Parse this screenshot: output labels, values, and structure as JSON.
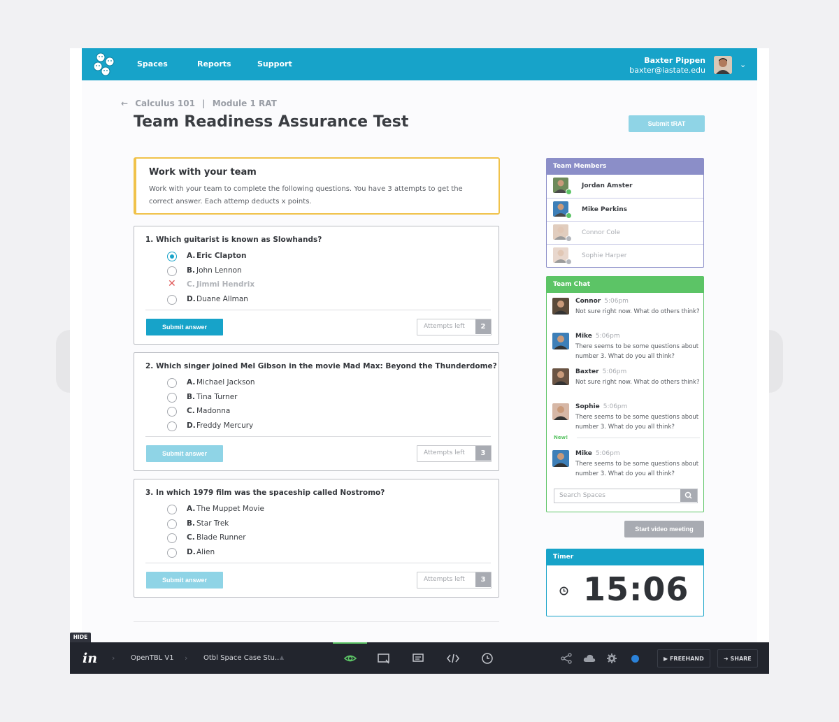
{
  "nav": {
    "links": [
      "Spaces",
      "Reports",
      "Support"
    ],
    "user_name": "Baxter Pippen",
    "user_email": "baxter@iastate.edu"
  },
  "breadcrumb": {
    "course": "Calculus 101",
    "separator": "|",
    "module": "Module 1 RAT"
  },
  "page": {
    "title": "Team Readiness Assurance Test",
    "submit_label": "Submit tRAT"
  },
  "notice": {
    "title": "Work with your team",
    "body": "Work with your team to complete the following questions. You have 3 attempts to get the correct answer. Each attemp deducts x points."
  },
  "questions": [
    {
      "title": "1. Which guitarist is known as Slowhands?",
      "options": [
        {
          "letter": "A.",
          "text": "Eric Clapton",
          "state": "selected"
        },
        {
          "letter": "B.",
          "text": "John Lennon",
          "state": "none"
        },
        {
          "letter": "C.",
          "text": "Jimmi Hendrix",
          "state": "wrong"
        },
        {
          "letter": "D.",
          "text": "Duane Allman",
          "state": "none"
        }
      ],
      "submit_label": "Submit answer",
      "attempts_label": "Attempts left",
      "attempts_left": "2"
    },
    {
      "title": "2.  Which singer joined Mel Gibson in the movie Mad Max: Beyond the Thunderdome?",
      "options": [
        {
          "letter": "A.",
          "text": "Michael Jackson",
          "state": "none"
        },
        {
          "letter": "B.",
          "text": "Tina Turner",
          "state": "none"
        },
        {
          "letter": "C.",
          "text": "Madonna",
          "state": "none"
        },
        {
          "letter": "D.",
          "text": "Freddy Mercury",
          "state": "none"
        }
      ],
      "submit_label": "Submit answer",
      "attempts_label": "Attempts left",
      "attempts_left": "3"
    },
    {
      "title": "3.  In which 1979 film was the spaceship called Nostromo?",
      "options": [
        {
          "letter": "A.",
          "text": "The Muppet Movie",
          "state": "none"
        },
        {
          "letter": "B.",
          "text": "Star Trek",
          "state": "none"
        },
        {
          "letter": "C.",
          "text": "Blade Runner",
          "state": "none"
        },
        {
          "letter": "D.",
          "text": "Alien",
          "state": "none"
        }
      ],
      "submit_label": "Submit answer",
      "attempts_label": "Attempts left",
      "attempts_left": "3"
    }
  ],
  "team": {
    "title": "Team Members",
    "members": [
      {
        "name": "Jordan Amster",
        "status": "online"
      },
      {
        "name": "Mike Perkins",
        "status": "online"
      },
      {
        "name": "Connor Cole",
        "status": "offline"
      },
      {
        "name": "Sophie Harper",
        "status": "offline"
      }
    ]
  },
  "chat": {
    "title": "Team Chat",
    "new_label": "New!",
    "messages": [
      {
        "name": "Connor",
        "time": "5:06pm",
        "text": "Not sure right now. What do others think?"
      },
      {
        "name": "Mike",
        "time": "5:06pm",
        "text": "There seems to be some questions about number 3. What do you all think?"
      },
      {
        "name": "Baxter",
        "time": "5:06pm",
        "text": "Not sure right now. What do others think?"
      },
      {
        "name": "Sophie",
        "time": "5:06pm",
        "text": "There seems to be some questions about number 3. What do you all think?"
      },
      {
        "name": "Mike",
        "time": "5:06pm",
        "text": "There seems to be some questions about number 3. What do you all think?"
      }
    ],
    "search_placeholder": "Search Spaces"
  },
  "video_label": "Start video meeting",
  "timer": {
    "title": "Timer",
    "value": "15:06"
  },
  "toolbar": {
    "hide_label": "HIDE",
    "logo": "in",
    "project": "OpenTBL V1",
    "screen": "Otbl Space Case Stu...",
    "freehand_label": "FREEHAND",
    "share_label": "SHARE",
    "icons": [
      "eye-icon",
      "comment-mode-icon",
      "comment-icon",
      "code-icon",
      "history-icon",
      "share-nodes-icon",
      "cloud-icon",
      "settings-icon"
    ]
  },
  "colors": {
    "primary": "#17a3c9",
    "team_members": "#8b8ec8",
    "team_chat": "#5cc466",
    "notice_border": "#f0c24a",
    "wrong": "#e05a5a"
  }
}
